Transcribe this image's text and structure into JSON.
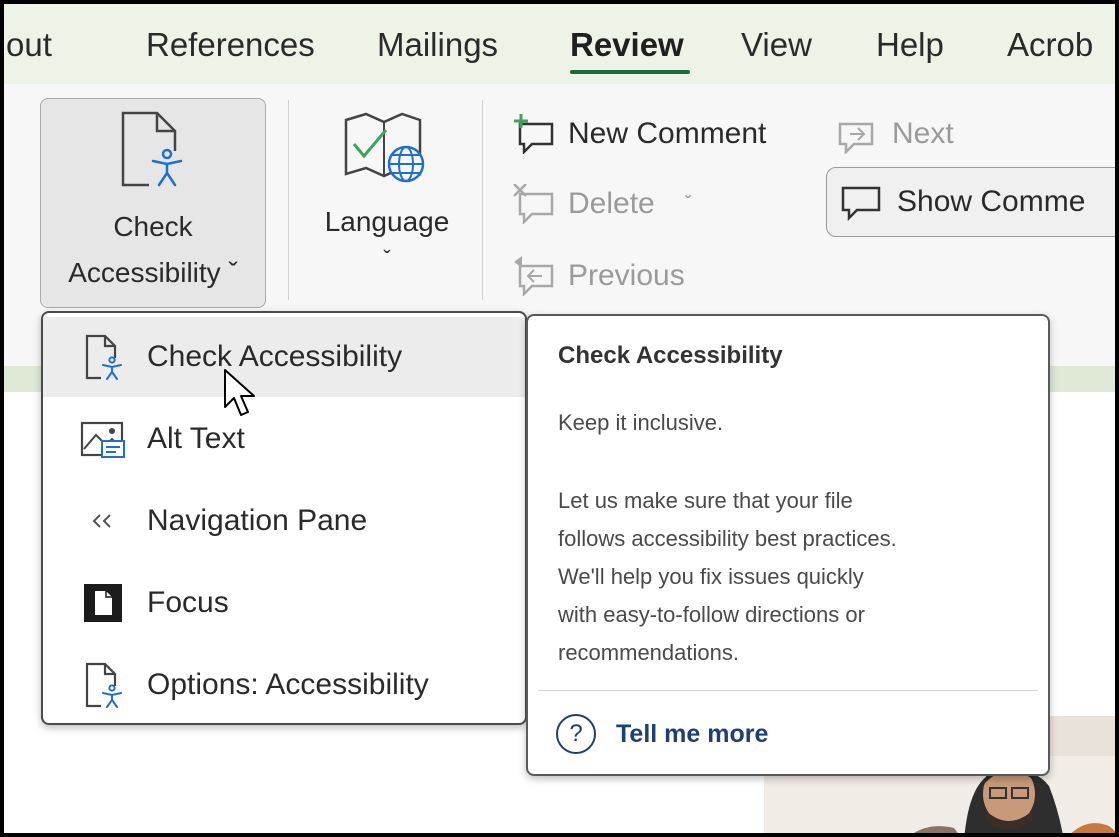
{
  "tabs": [
    {
      "label": "out"
    },
    {
      "label": "References"
    },
    {
      "label": "Mailings"
    },
    {
      "label": "Review"
    },
    {
      "label": "View"
    },
    {
      "label": "Help"
    },
    {
      "label": "Acrob"
    }
  ],
  "active_tab": "Review",
  "ribbon": {
    "check_accessibility": {
      "line1": "Check",
      "line2": "Accessibility ˇ"
    },
    "language": {
      "label": "Language",
      "chevron": "ˇ"
    },
    "comments": {
      "new_comment": "New Comment",
      "next": "Next",
      "delete": "Delete",
      "delete_chevron": "ˇ",
      "previous": "Previous",
      "show_comments": "Show Comme"
    }
  },
  "dropdown": {
    "items": [
      {
        "label": "Check Accessibility",
        "icon": "check-accessibility-icon"
      },
      {
        "label": "Alt Text",
        "icon": "alt-text-icon"
      },
      {
        "label": "Navigation Pane",
        "icon": "navigation-pane-icon"
      },
      {
        "label": "Focus",
        "icon": "focus-icon"
      },
      {
        "label": "Options: Accessibility",
        "icon": "options-accessibility-icon"
      }
    ]
  },
  "tooltip": {
    "title": "Check Accessibility",
    "subtitle": "Keep it inclusive.",
    "body_lines": [
      "Let us make sure that your file",
      "follows accessibility best practices.",
      "We'll help you fix issues quickly",
      "with easy-to-follow directions or",
      "recommendations."
    ],
    "link": "Tell me more",
    "link_icon": "?"
  },
  "colors": {
    "tab_band": "#eef3e8",
    "active_underline": "#1e6a3a",
    "accessibility_blue": "#1e6fd1",
    "link": "#1d3f73"
  }
}
